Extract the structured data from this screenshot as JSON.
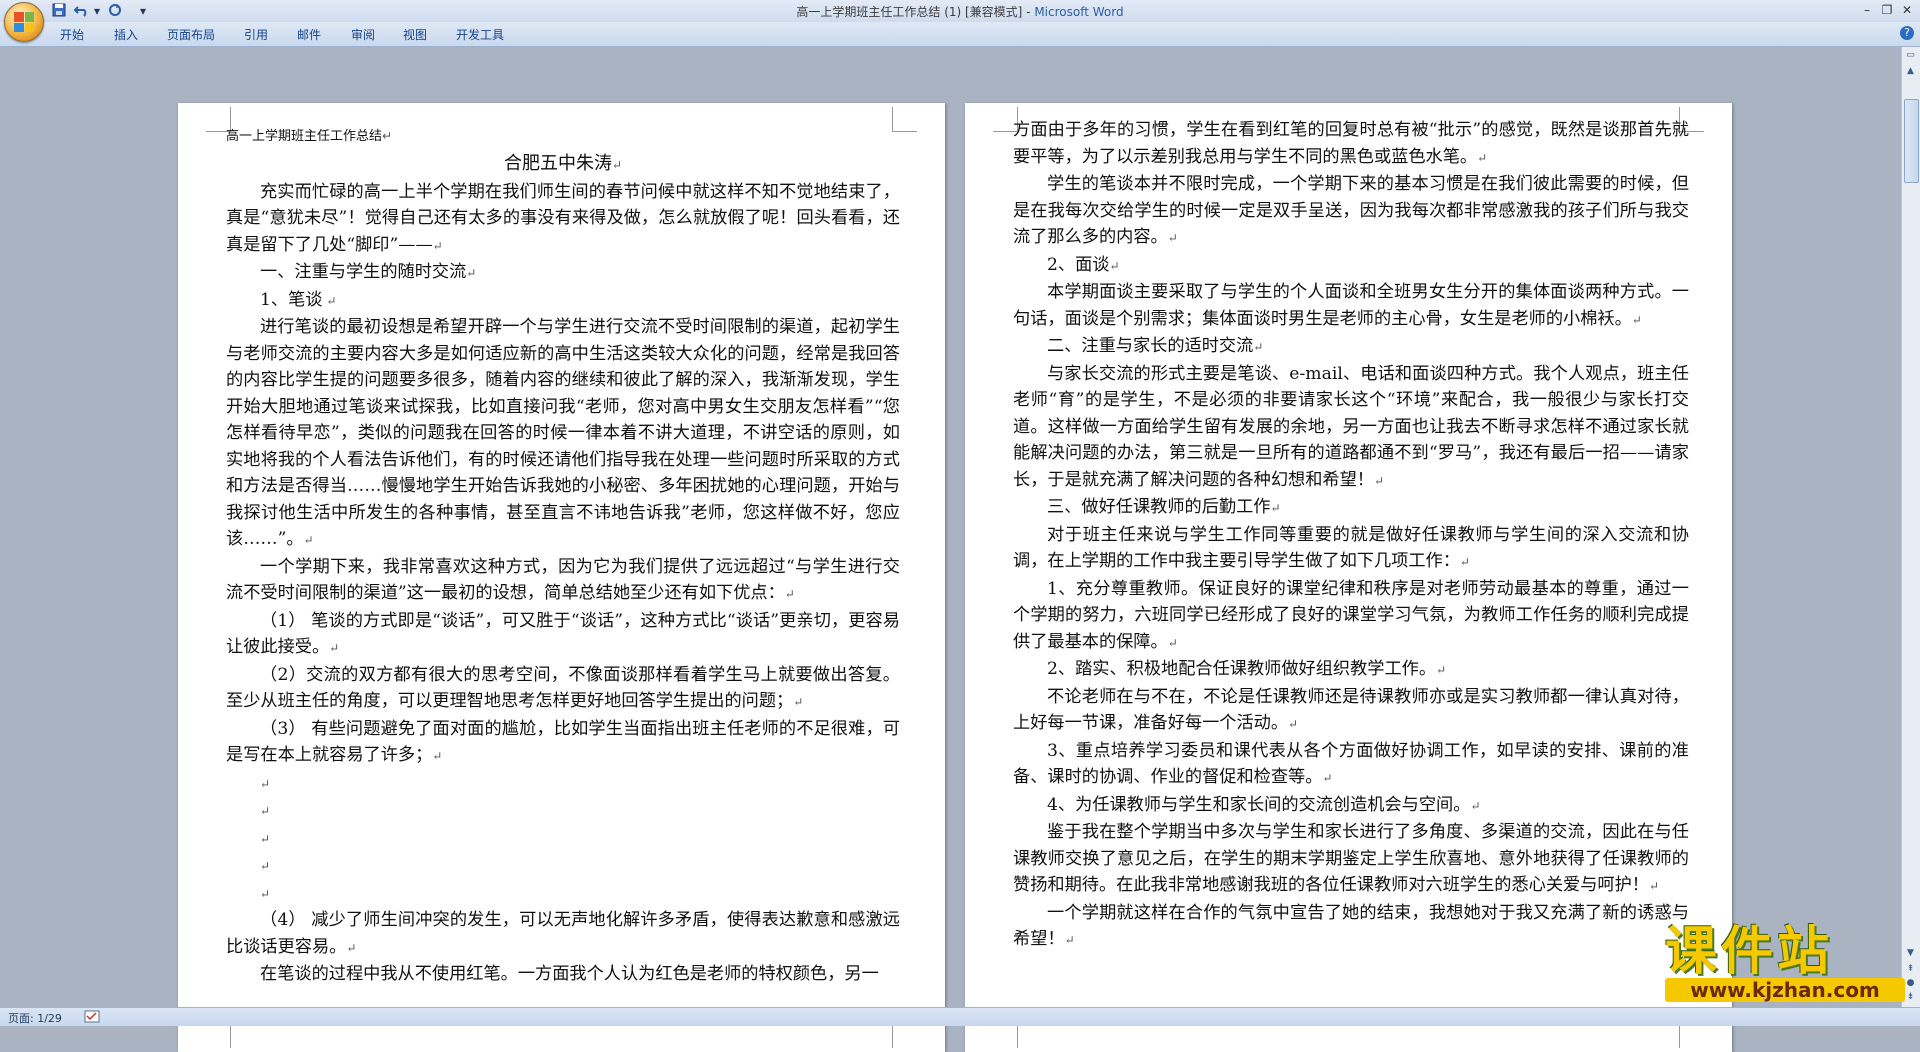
{
  "window": {
    "title": "高一上学期班主任工作总结 (1) [兼容模式] - ",
    "app_name": "Microsoft Word"
  },
  "quick_access": {
    "save": "save-icon",
    "undo": "undo-icon",
    "redo": "redo-icon",
    "customize": "▾"
  },
  "window_controls": {
    "minimize": "–",
    "restore": "❐",
    "close": "✕"
  },
  "ribbon": {
    "tabs": [
      "开始",
      "插入",
      "页面布局",
      "引用",
      "邮件",
      "审阅",
      "视图",
      "开发工具"
    ],
    "help": "?"
  },
  "left_page": {
    "header": "高一上学期班主任工作总结",
    "heading": "合肥五中朱涛",
    "paragraphs": [
      "充实而忙碌的高一上半个学期在我们师生间的春节问候中就这样不知不觉地结束了，真是“意犹未尽”！觉得自己还有太多的事没有来得及做，怎么就放假了呢！回头看看，还真是留下了几处“脚印”——",
      "一、注重与学生的随时交流",
      "1、笔谈",
      "进行笔谈的最初设想是希望开辟一个与学生进行交流不受时间限制的渠道，起初学生与老师交流的主要内容大多是如何适应新的高中生活这类较大众化的问题，经常是我回答的内容比学生提的问题要多很多，随着内容的继续和彼此了解的深入，我渐渐发现，学生开始大胆地通过笔谈来试探我，比如直接问我“老师，您对高中男女生交朋友怎样看”“您怎样看待早恋”，类似的问题我在回答的时候一律本着不讲大道理，不讲空话的原则，如实地将我的个人看法告诉他们，有的时候还请他们指导我在处理一些问题时所采取的方式和方法是否得当……慢慢地学生开始告诉我她的小秘密、多年困扰她的心理问题，开始与我探讨他生活中所发生的各种事情，甚至直言不讳地告诉我”老师，您这样做不好，您应该……”。",
      "一个学期下来，我非常喜欢这种方式，因为它为我们提供了远远超过“与学生进行交流不受时间限制的渠道”这一最初的设想，简单总结她至少还有如下优点：",
      "（1） 笔谈的方式即是“谈话”，可又胜于“谈话”，这种方式比“谈话”更亲切，更容易让彼此接受。",
      "（2）交流的双方都有很大的思考空间，不像面谈那样看着学生马上就要做出答复。至少从班主任的角度，可以更理智地思考怎样更好地回答学生提出的问题；",
      "（3） 有些问题避免了面对面的尴尬，比如学生当面指出班主任老师的不足很难，可是写在本上就容易了许多；",
      "（4） 减少了师生间冲突的发生，可以无声地化解许多矛盾，使得表达歉意和感激远比谈话更容易。",
      "在笔谈的过程中我从不使用红笔。一方面我个人认为红色是老师的特权颜色，另一"
    ]
  },
  "right_page": {
    "paragraphs": [
      "方面由于多年的习惯，学生在看到红笔的回复时总有被“批示”的感觉，既然是谈那首先就要平等，为了以示差别我总用与学生不同的黑色或蓝色水笔。",
      "学生的笔谈本并不限时完成，一个学期下来的基本习惯是在我们彼此需要的时候，但是在我每次交给学生的时候一定是双手呈送，因为我每次都非常感激我的孩子们所与我交流了那么多的内容。",
      "2、面谈",
      "本学期面谈主要采取了与学生的个人面谈和全班男女生分开的集体面谈两种方式。一句话，面谈是个别需求；集体面谈时男生是老师的主心骨，女生是老师的小棉袄。",
      "二、注重与家长的适时交流",
      "与家长交流的形式主要是笔谈、e-mail、电话和面谈四种方式。我个人观点，班主任老师“育”的是学生，不是必须的非要请家长这个“环境”来配合，我一般很少与家长打交道。这样做一方面给学生留有发展的余地，另一方面也让我去不断寻求怎样不通过家长就能解决问题的办法，第三就是一旦所有的道路都通不到“罗马”，我还有最后一招——请家长，于是就充满了解决问题的各种幻想和希望！",
      "三、做好任课教师的后勤工作",
      "对于班主任来说与学生工作同等重要的就是做好任课教师与学生间的深入交流和协调，在上学期的工作中我主要引导学生做了如下几项工作：",
      "1、充分尊重教师。保证良好的课堂纪律和秩序是对老师劳动最基本的尊重，通过一个学期的努力，六班同学已经形成了良好的课堂学习气氛，为教师工作任务的顺利完成提供了最基本的保障。",
      "2、踏实、积极地配合任课教师做好组织教学工作。",
      "不论老师在与不在，不论是任课教师还是待课教师亦或是实习教师都一律认真对待，上好每一节课，准备好每一个活动。",
      "3、重点培养学习委员和课代表从各个方面做好协调工作，如早读的安排、课前的准备、课时的协调、作业的督促和检查等。",
      "4、为任课教师与学生和家长间的交流创造机会与空间。",
      "鉴于我在整个学期当中多次与学生和家长进行了多角度、多渠道的交流，因此在与任课教师交换了意见之后，在学生的期末学期鉴定上学生欣喜地、意外地获得了任课教师的赞扬和期待。在此我非常地感谢我班的各位任课教师对六班学生的悉心关爱与呵护！",
      "一个学期就这样在合作的气氛中宣告了她的结束，我想她对于我又充满了新的诱惑与希望！"
    ]
  },
  "status_bar": {
    "page": "页面: 1/29"
  },
  "watermark": {
    "brand": "课件站",
    "url": "www.kjzhan.com"
  }
}
